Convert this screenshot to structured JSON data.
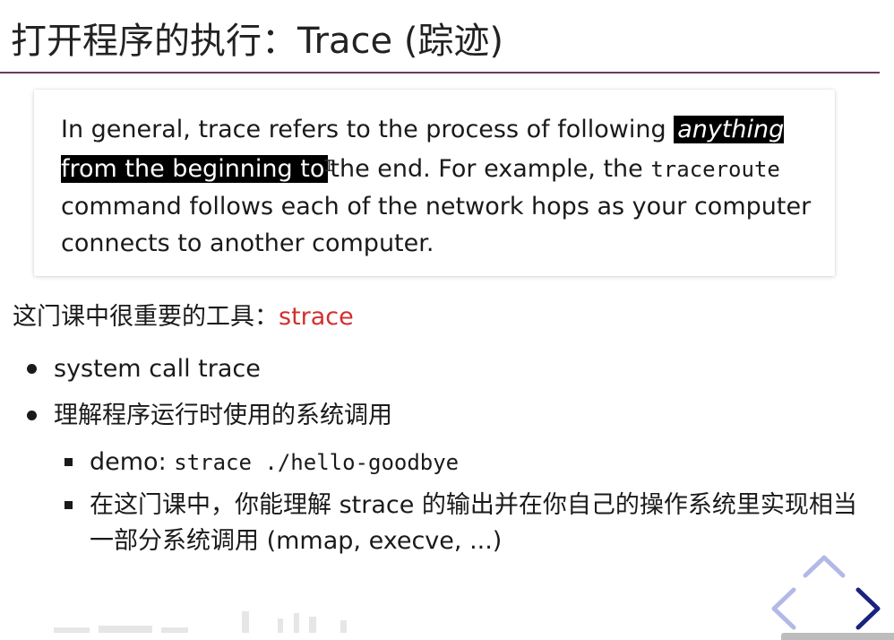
{
  "slide": {
    "title": "打开程序的执行：Trace (踪迹)"
  },
  "quote": {
    "before": "In general, trace refers to the process of following ",
    "highlight_italic": "anything",
    "highlight_rest": " from the beginning to",
    "after_cursor": "the end. For example, the ",
    "code": "traceroute",
    "end": " command follows each of the network hops as your computer connects to another computer."
  },
  "tools_line": {
    "prefix": "这门课中很重要的工具：",
    "tool": "strace"
  },
  "bullets": [
    {
      "text": "system call trace"
    },
    {
      "text": "理解程序运行时使用的系统调用"
    }
  ],
  "sub_bullets": [
    {
      "label": "demo: ",
      "code": "strace ./hello-goodbye"
    },
    {
      "text": "在这门课中，你能理解 strace 的输出并在你自己的操作系统里实现相当一部分系统调用 (mmap, execve, ...)"
    }
  ],
  "nav": {
    "up": "up-arrow-icon",
    "left": "left-arrow-icon",
    "right": "right-arrow-icon"
  },
  "colors": {
    "title_rule": "#6a3a5a",
    "accent_red": "#d32f2f",
    "nav_inactive": "#b3b8e8",
    "nav_active": "#1a237e",
    "highlight": "#000000"
  }
}
